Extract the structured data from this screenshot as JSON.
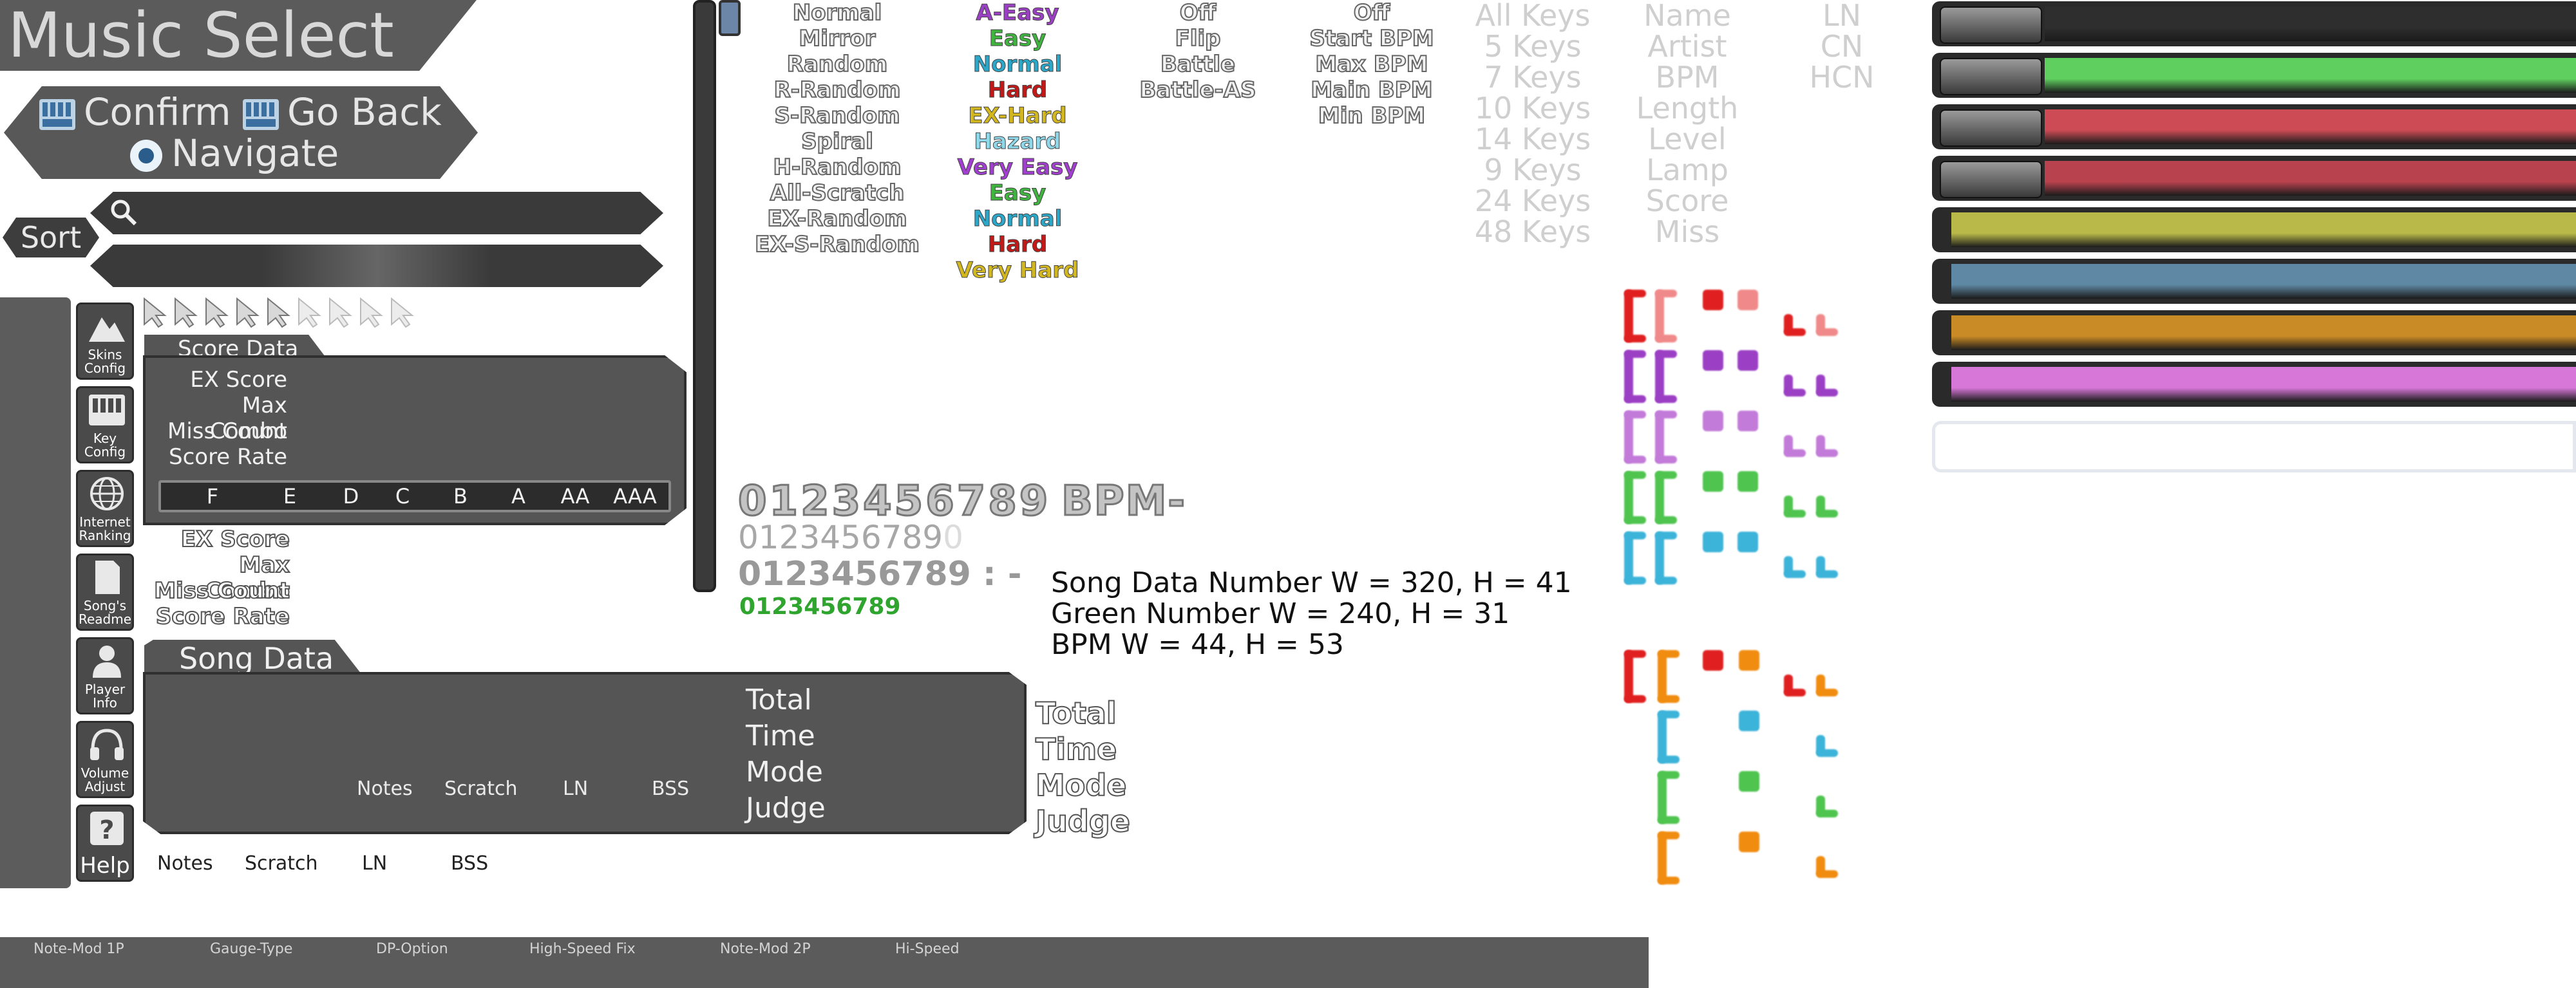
{
  "title": "Music Select",
  "nav_hints": {
    "confirm": "Confirm",
    "go_back": "Go Back",
    "navigate": "Navigate"
  },
  "sort_label": "Sort",
  "sidebar": {
    "items": [
      {
        "label": "Skins Config",
        "icon": "mountain-icon"
      },
      {
        "label": "Key Config",
        "icon": "keyboard-icon"
      },
      {
        "label": "Internet Ranking",
        "icon": "globe-icon"
      },
      {
        "label": "Song's Readme",
        "icon": "document-icon"
      },
      {
        "label": "Player Info",
        "icon": "person-icon"
      },
      {
        "label": "Volume Adjust",
        "icon": "headphones-icon"
      },
      {
        "label": "Help",
        "icon": "question-icon"
      }
    ]
  },
  "score_data": {
    "tab": "Score Data",
    "labels": [
      "EX Score",
      "Max Combo",
      "Miss Count",
      "Score Rate"
    ],
    "grades": [
      "F",
      "E",
      "D",
      "C",
      "B",
      "A",
      "AA",
      "AAA"
    ],
    "labels_outline": [
      "EX Score",
      "Max Combo",
      "Miss Count",
      "Score Rate"
    ]
  },
  "song_data": {
    "tab": "Song Data",
    "right_labels": [
      "Total",
      "Time",
      "Mode",
      "Judge"
    ],
    "bottom_labels": [
      "Notes",
      "Scratch",
      "LN",
      "BSS"
    ],
    "outside_right_labels": [
      "Total",
      "Time",
      "Mode",
      "Judge"
    ],
    "outside_bottom_labels": [
      "Notes",
      "Scratch",
      "LN",
      "BSS"
    ]
  },
  "random_options": [
    "Normal",
    "Mirror",
    "Random",
    "R-Random",
    "S-Random",
    "Spiral",
    "H-Random",
    "All-Scratch",
    "EX-Random",
    "EX-S-Random"
  ],
  "gauge_options": [
    {
      "label": "A-Easy",
      "color": "#9b3fc4"
    },
    {
      "label": "Easy",
      "color": "#3fb53f"
    },
    {
      "label": "Normal",
      "color": "#2aa7c9"
    },
    {
      "label": "Hard",
      "color": "#c21818"
    },
    {
      "label": "EX-Hard",
      "color": "#d2b81e"
    },
    {
      "label": "Hazard",
      "color": "#8fd8ea"
    },
    {
      "label": "Very Easy",
      "color": "#a23fd0"
    },
    {
      "label": "Easy",
      "color": "#3fb53f"
    },
    {
      "label": "Normal",
      "color": "#2aa7c9"
    },
    {
      "label": "Hard",
      "color": "#c21818"
    },
    {
      "label": "Very Hard",
      "color": "#d2b81e"
    }
  ],
  "dp_options": [
    "Off",
    "Flip",
    "Battle",
    "Battle-AS"
  ],
  "hs_fix_options": [
    "Off",
    "Start BPM",
    "Max BPM",
    "Main BPM",
    "Min BPM"
  ],
  "key_filters": [
    "All Keys",
    "5 Keys",
    "7 Keys",
    "10 Keys",
    "14 Keys",
    "9 Keys",
    "24 Keys",
    "48 Keys"
  ],
  "sort_options": [
    "Name",
    "Artist",
    "BPM",
    "Length",
    "Level",
    "Lamp",
    "Score",
    "Miss"
  ],
  "ln_options": [
    "LN",
    "CN",
    "HCN"
  ],
  "numbers": {
    "big": "0123456789",
    "bpm": "BPM-",
    "mid": "0123456789",
    "mid_extra": "0",
    "time": "0123456789 :  -",
    "green": "0123456789"
  },
  "info_lines": [
    "Song Data Number W = 320, H = 41",
    "Green Number W = 240, H = 31",
    "BPM W = 44, H = 53"
  ],
  "bottom_bar": [
    "Note-Mod 1P",
    "Gauge-Type",
    "DP-Option",
    "High-Speed Fix",
    "Note-Mod 2P",
    "Hi-Speed"
  ],
  "song_bar_colors": [
    "#2e2e2e",
    "#5fcf5f",
    "#cc4b55",
    "#b8424d",
    "#b9b94a",
    "#5e88a3",
    "#c98b25",
    "#d777d8"
  ],
  "note_colors": [
    "#e02020",
    "#f08a8a",
    "#9b3fc4",
    "#c27bd8",
    "#4fc44f",
    "#3cb3d8",
    "#f08c10"
  ]
}
